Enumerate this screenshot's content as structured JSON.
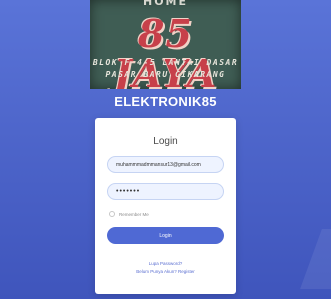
{
  "sign": {
    "top_text": "HOME",
    "big_text": "85 JAYA",
    "line1": "BLOK F 4-5 LANTAI DASAR",
    "line2": "PASAR BARU CIKARANG"
  },
  "brand": "ELEKTRONIK85",
  "login": {
    "title": "Login",
    "email_value": "muhammmadmmansur13@gmail.com",
    "password_value": "•••••••",
    "remember_label": "Remember Me",
    "button_label": "Login",
    "forgot_link": "Lupa Password?",
    "register_link": "Belum Punya Akun? Register"
  },
  "colors": {
    "background": "#4f67cc",
    "primary": "#4f69d4",
    "input_bg": "#eef3ff"
  }
}
